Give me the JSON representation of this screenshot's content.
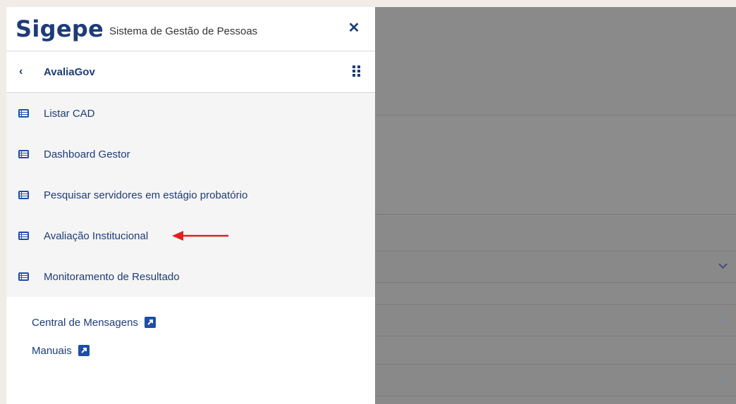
{
  "header": {
    "logo": "Sigepe",
    "subtitle": "Sistema de Gestão de Pessoas",
    "close_icon": "close-icon"
  },
  "subheader": {
    "back_icon": "chevron-left-icon",
    "title": "AvaliaGov",
    "apps_icon": "grid-icon"
  },
  "menu": {
    "items": [
      {
        "label": "Listar CAD",
        "icon": "list-icon"
      },
      {
        "label": "Dashboard Gestor",
        "icon": "list-icon"
      },
      {
        "label": "Pesquisar servidores em estágio probatório",
        "icon": "list-icon"
      },
      {
        "label": "Avaliação Institucional",
        "icon": "list-icon"
      },
      {
        "label": "Monitoramento de Resultado",
        "icon": "list-icon"
      }
    ]
  },
  "links": [
    {
      "label": "Central de Mensagens",
      "icon": "external-link-icon"
    },
    {
      "label": "Manuais",
      "icon": "external-link-icon"
    }
  ],
  "annotation": {
    "icon": "red-arrow-icon",
    "color": "#e02020"
  },
  "colors": {
    "brand": "#1d3c78",
    "icon_blue": "#1d4fa5",
    "overlay": "#8a8a8a"
  }
}
